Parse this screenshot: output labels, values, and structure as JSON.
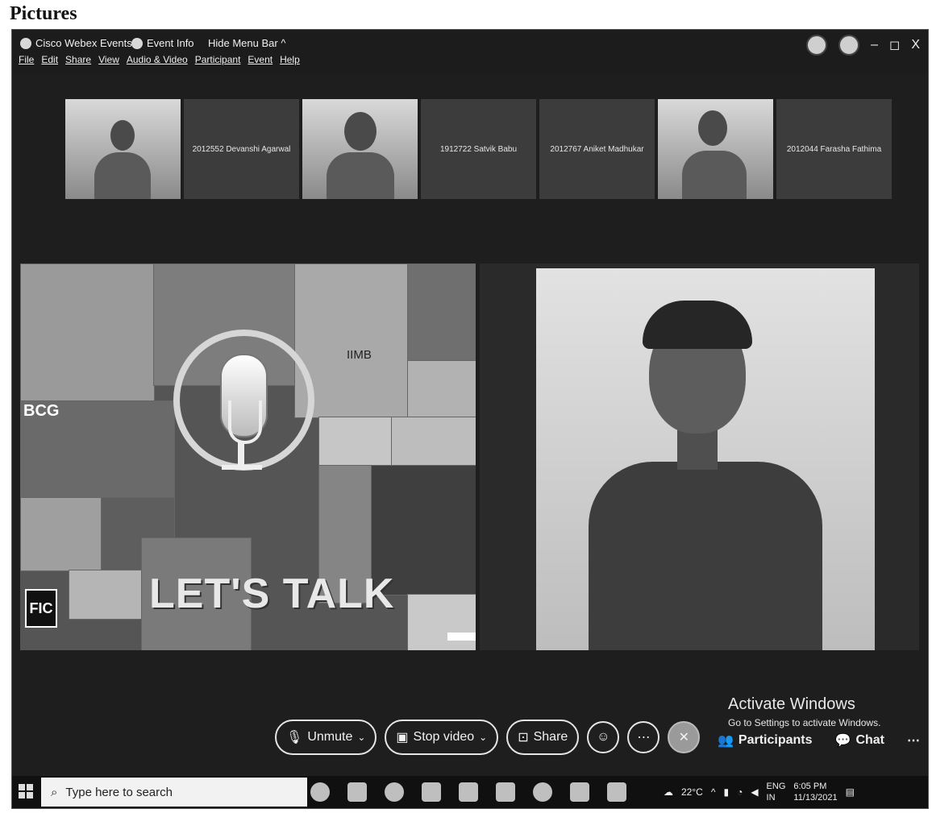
{
  "heading": "Pictures",
  "topbar": {
    "app_name": "Cisco Webex Events",
    "event_info": "Event Info",
    "hide_menu": "Hide Menu Bar ^",
    "minimize": "–",
    "restore": "◻",
    "close": "X"
  },
  "menu": [
    "File",
    "Edit",
    "Share",
    "View",
    "Audio & Video",
    "Participant",
    "Event",
    "Help"
  ],
  "participants": [
    {
      "name": "",
      "video": true
    },
    {
      "name": "2012552 Devanshi Agarwal",
      "video": false
    },
    {
      "name": "",
      "video": true
    },
    {
      "name": "1912722 Satvik Babu",
      "video": false
    },
    {
      "name": "2012767 Aniket Madhukar",
      "video": false
    },
    {
      "name": "",
      "video": true
    },
    {
      "name": "2012044 Farasha Fathima",
      "video": false
    }
  ],
  "shared_content": {
    "headline": "LET'S TALK",
    "logo_bcg": "BCG",
    "logo_iimb": "IIMB",
    "logo_fic": "FIC"
  },
  "watermark": {
    "title": "Activate Windows",
    "subtitle": "Go to Settings to activate Windows."
  },
  "controls": {
    "unmute": "Unmute",
    "stop_video": "Stop video",
    "share": "Share",
    "participants": "Participants",
    "chat": "Chat"
  },
  "taskbar": {
    "search_placeholder": "Type here to search",
    "temperature": "22°C",
    "lang": "ENG",
    "region": "IN",
    "time": "6:05 PM",
    "date": "11/13/2021"
  }
}
